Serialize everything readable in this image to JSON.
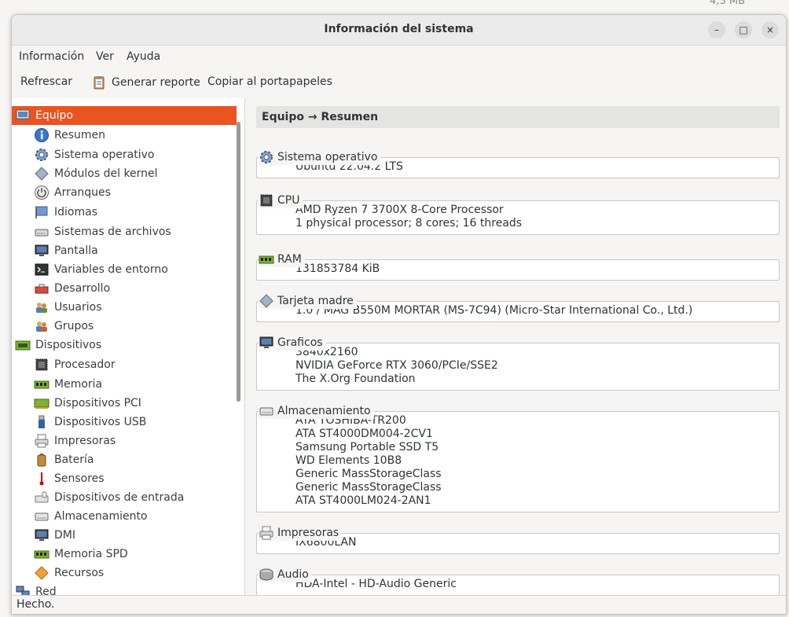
{
  "background_text": "4,3 MB",
  "window": {
    "title": "Información del sistema",
    "buttons": {
      "minimize": "–",
      "maximize": "□",
      "close": "×"
    }
  },
  "menubar": {
    "items": [
      "Información",
      "Ver",
      "Ayuda"
    ]
  },
  "toolbar": {
    "refresh": "Refrescar",
    "report": "Generar reporte",
    "copy": "Copiar al portapapeles"
  },
  "sidebar": {
    "items": [
      {
        "label": "Equipo",
        "icon": "computer-icon",
        "level": 0,
        "selected": true
      },
      {
        "label": "Resumen",
        "icon": "info-icon",
        "level": 1
      },
      {
        "label": "Sistema operativo",
        "icon": "gear-icon",
        "level": 1
      },
      {
        "label": "Módulos del kernel",
        "icon": "diamond-icon",
        "level": 1
      },
      {
        "label": "Arranques",
        "icon": "power-icon",
        "level": 1
      },
      {
        "label": "Idiomas",
        "icon": "flag-icon",
        "level": 1
      },
      {
        "label": "Sistemas de archivos",
        "icon": "drive-icon",
        "level": 1
      },
      {
        "label": "Pantalla",
        "icon": "monitor-icon",
        "level": 1
      },
      {
        "label": "Variables de entorno",
        "icon": "terminal-icon",
        "level": 1
      },
      {
        "label": "Desarrollo",
        "icon": "toolbox-icon",
        "level": 1
      },
      {
        "label": "Usuarios",
        "icon": "users-icon",
        "level": 1
      },
      {
        "label": "Grupos",
        "icon": "group-icon",
        "level": 1
      },
      {
        "label": "Dispositivos",
        "icon": "board-icon",
        "level": 0
      },
      {
        "label": "Procesador",
        "icon": "cpu-icon",
        "level": 1
      },
      {
        "label": "Memoria",
        "icon": "ram-icon",
        "level": 1
      },
      {
        "label": "Dispositivos PCI",
        "icon": "pci-icon",
        "level": 1
      },
      {
        "label": "Dispositivos USB",
        "icon": "usb-icon",
        "level": 1
      },
      {
        "label": "Impresoras",
        "icon": "printer-icon",
        "level": 1
      },
      {
        "label": "Batería",
        "icon": "battery-icon",
        "level": 1
      },
      {
        "label": "Sensores",
        "icon": "thermometer-icon",
        "level": 1
      },
      {
        "label": "Dispositivos de entrada",
        "icon": "keyboard-icon",
        "level": 1
      },
      {
        "label": "Almacenamiento",
        "icon": "disk-icon",
        "level": 1
      },
      {
        "label": "DMI",
        "icon": "monitor-icon",
        "level": 1
      },
      {
        "label": "Memoria SPD",
        "icon": "ram-icon",
        "level": 1
      },
      {
        "label": "Recursos",
        "icon": "resources-icon",
        "level": 1
      },
      {
        "label": "Red",
        "icon": "network-icon",
        "level": 0
      }
    ]
  },
  "main": {
    "header": "Equipo → Resumen",
    "sections": [
      {
        "title": "Sistema operativo",
        "icon": "gear-icon",
        "lines": [
          "Ubuntu 22.04.2 LTS"
        ]
      },
      {
        "title": "CPU",
        "icon": "cpu-icon",
        "lines": [
          "AMD Ryzen 7 3700X 8-Core Processor",
          "1 physical processor; 8 cores; 16 threads"
        ]
      },
      {
        "title": "RAM",
        "icon": "ram-icon",
        "lines": [
          "131853784 KiB"
        ]
      },
      {
        "title": "Tarjeta madre",
        "icon": "diamond-icon",
        "lines": [
          "1.0 / MAG B550M MORTAR (MS-7C94) (Micro-Star International Co., Ltd.)"
        ]
      },
      {
        "title": "Graficos",
        "icon": "monitor-icon",
        "lines": [
          "3840x2160",
          "NVIDIA GeForce RTX 3060/PCIe/SSE2",
          "The X.Org Foundation"
        ]
      },
      {
        "title": "Almacenamiento",
        "icon": "disk-icon",
        "lines": [
          "ATA TOSHIBA-TR200",
          "ATA ST4000DM004-2CV1",
          "Samsung Portable SSD T5",
          "WD Elements 10B8",
          "Generic MassStorageClass",
          "Generic MassStorageClass",
          "ATA ST4000LM024-2AN1"
        ]
      },
      {
        "title": "Impresoras",
        "icon": "printer-icon",
        "lines": [
          "IX6800LAN"
        ]
      },
      {
        "title": "Audio",
        "icon": "audio-icon",
        "lines": [
          "HDA-Intel - HD-Audio Generic"
        ]
      }
    ]
  },
  "statusbar": {
    "text": "Hecho."
  },
  "colors": {
    "selection": "#e95420",
    "panel": "#ffffff",
    "header_strip": "#e4e4e2"
  }
}
